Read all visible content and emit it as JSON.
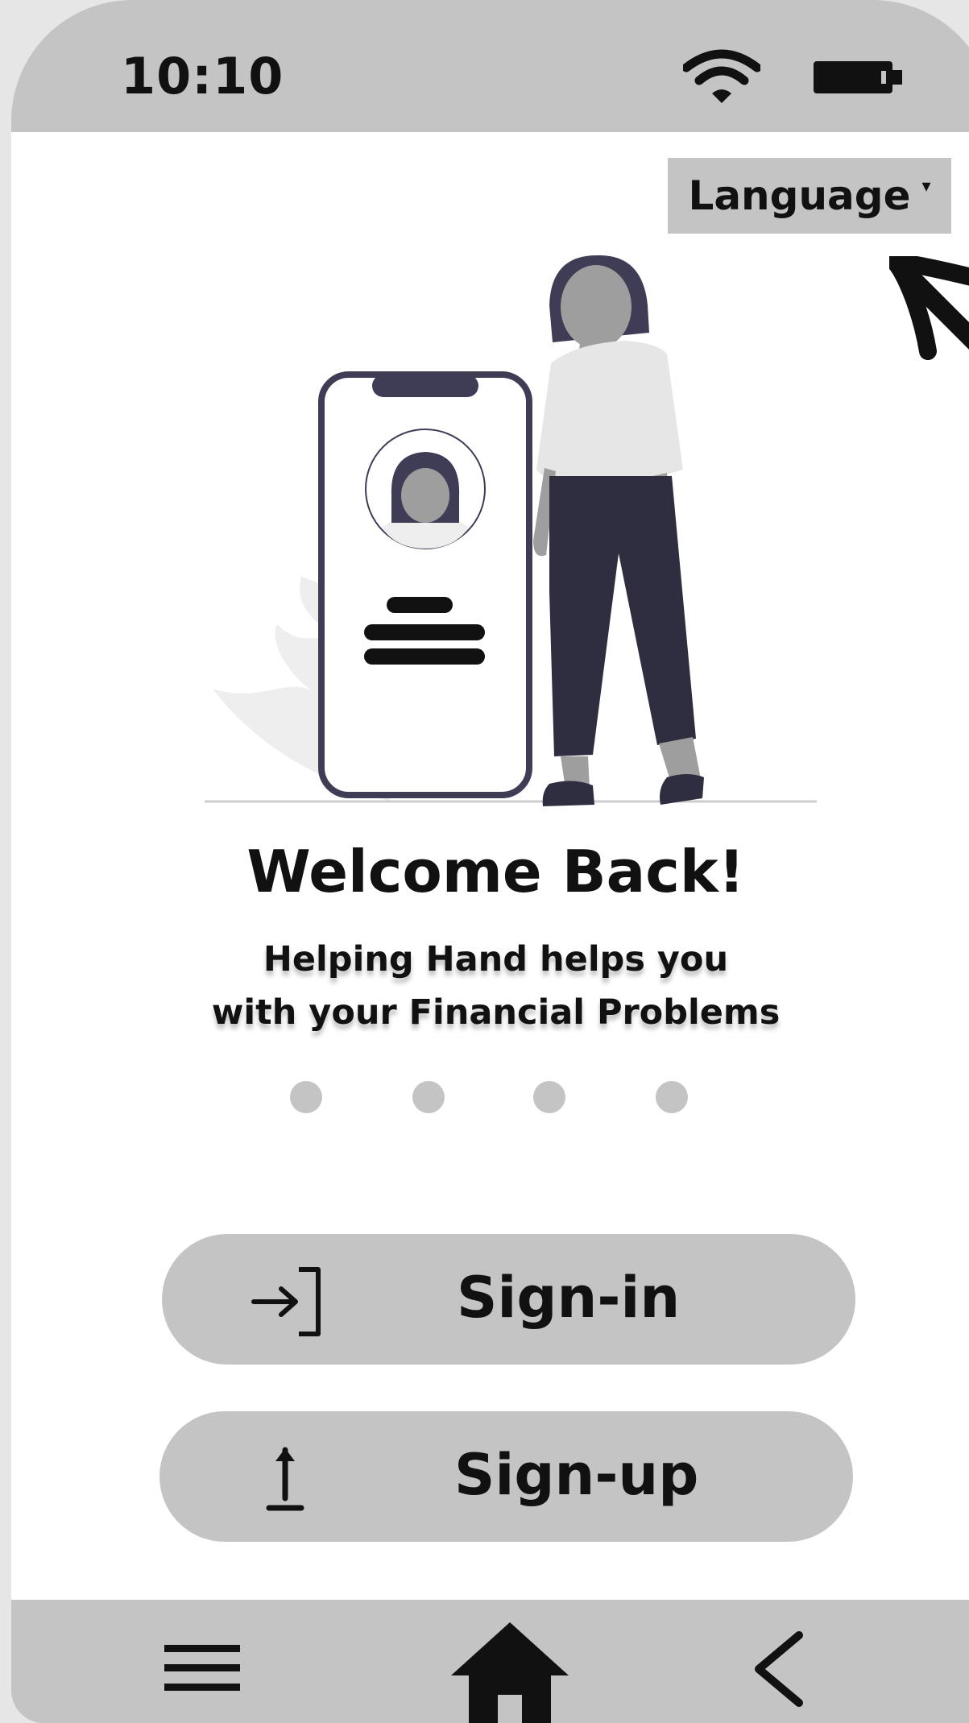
{
  "status_bar": {
    "time": "10:10",
    "icons": [
      "wifi-icon",
      "battery-icon"
    ]
  },
  "language_select": {
    "label": "Language",
    "caret": "▾"
  },
  "welcome": {
    "title": "Welcome Back!",
    "subtitle_line1": "Helping Hand helps you",
    "subtitle_line2": "with your Financial Problems"
  },
  "pager": {
    "dot_count": 4,
    "active_index": null
  },
  "buttons": {
    "signin": {
      "label": "Sign-in",
      "icon": "login-arrow-icon"
    },
    "signup": {
      "label": "Sign-up",
      "icon": "upload-arrow-icon"
    }
  },
  "nav_bar": {
    "items": [
      "menu-icon",
      "home-icon",
      "back-icon"
    ]
  },
  "colors": {
    "bar_gray": "#c4c4c4",
    "text": "#111111",
    "illustration_dark": "#2f2e41",
    "illustration_gray": "#9e9e9e",
    "illustration_light": "#e6e6e6"
  }
}
